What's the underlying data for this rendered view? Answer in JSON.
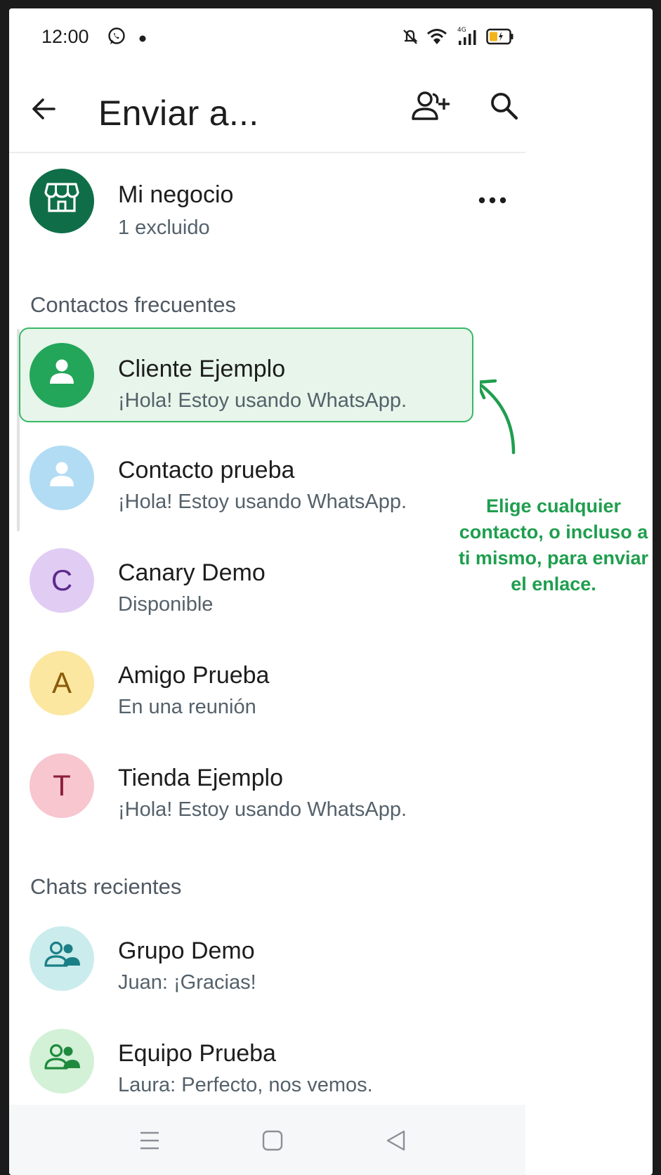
{
  "status_bar": {
    "time": "12:00"
  },
  "app_bar": {
    "title": "Enviar a..."
  },
  "business": {
    "name": "Mi negocio",
    "subtitle": "1 excluido"
  },
  "sections": {
    "frequent": "Contactos frecuentes",
    "recent": "Chats recientes"
  },
  "frequent_contacts": [
    {
      "name": "Cliente Ejemplo",
      "status": "¡Hola! Estoy usando WhatsApp."
    },
    {
      "name": "Contacto prueba",
      "status": "¡Hola! Estoy usando WhatsApp."
    },
    {
      "name": "Canary Demo",
      "status": "Disponible",
      "initial": "C"
    },
    {
      "name": "Amigo Prueba",
      "status": "En una reunión",
      "initial": "A"
    },
    {
      "name": "Tienda Ejemplo",
      "status": "¡Hola! Estoy usando WhatsApp.",
      "initial": "T"
    }
  ],
  "recent_chats": [
    {
      "name": "Grupo Demo",
      "last_message": "Juan: ¡Gracias!"
    },
    {
      "name": "Equipo Prueba",
      "last_message": "Laura: Perfecto, nos vemos."
    }
  ],
  "annotation": {
    "text": "Elige cualquier contacto, o incluso a ti mismo, para enviar el enlace."
  },
  "colors": {
    "brand_green": "#0f6e48",
    "highlight_border": "#38b866",
    "annotation_green": "#1f9e4e"
  },
  "icons": {
    "status_bar": [
      "whatsapp-icon",
      "dot-icon",
      "mute-icon",
      "wifi-icon",
      "signal-icon",
      "battery-icon"
    ],
    "app_bar": [
      "back-arrow-icon",
      "add-contact-icon",
      "search-icon"
    ],
    "navigation": [
      "menu-icon",
      "home-square-icon",
      "back-triangle-icon"
    ]
  }
}
